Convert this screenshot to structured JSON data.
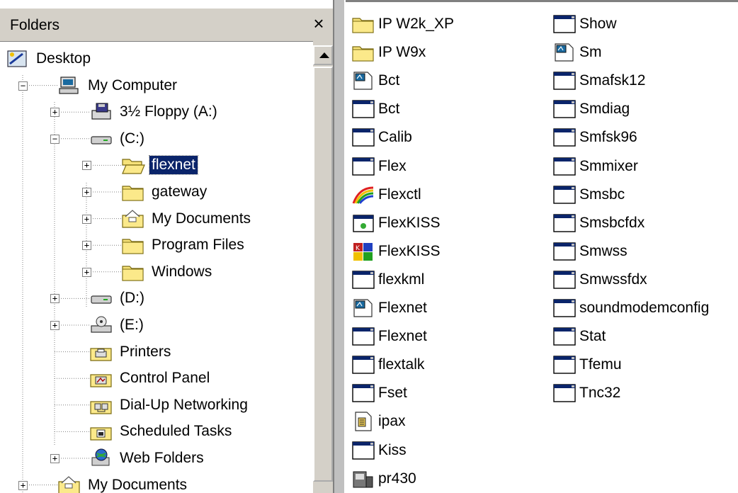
{
  "folders_header": {
    "title": "Folders",
    "close_glyph": "×"
  },
  "tree": [
    {
      "label": "Desktop",
      "icon": "desktop-icon",
      "level": 0,
      "expander": "none"
    },
    {
      "label": "My Computer",
      "icon": "computer-icon",
      "level": 1,
      "expander": "minus"
    },
    {
      "label": "3½ Floppy (A:)",
      "icon": "floppy-drive-icon",
      "level": 2,
      "expander": "plus"
    },
    {
      "label": "(C:)",
      "icon": "hard-drive-icon",
      "level": 2,
      "expander": "minus"
    },
    {
      "label": "flexnet",
      "icon": "open-folder-icon",
      "level": 3,
      "expander": "plus",
      "selected": true
    },
    {
      "label": "gateway",
      "icon": "folder-icon",
      "level": 3,
      "expander": "plus"
    },
    {
      "label": "My Documents",
      "icon": "documents-folder-icon",
      "level": 3,
      "expander": "plus"
    },
    {
      "label": "Program Files",
      "icon": "folder-icon",
      "level": 3,
      "expander": "plus"
    },
    {
      "label": "Windows",
      "icon": "folder-icon",
      "level": 3,
      "expander": "plus"
    },
    {
      "label": "(D:)",
      "icon": "hard-drive-icon",
      "level": 2,
      "expander": "plus"
    },
    {
      "label": "(E:)",
      "icon": "cd-drive-icon",
      "level": 2,
      "expander": "plus"
    },
    {
      "label": "Printers",
      "icon": "printers-folder-icon",
      "level": 2,
      "expander": "none"
    },
    {
      "label": "Control Panel",
      "icon": "control-panel-icon",
      "level": 2,
      "expander": "none"
    },
    {
      "label": "Dial-Up Networking",
      "icon": "dialup-networking-icon",
      "level": 2,
      "expander": "none"
    },
    {
      "label": "Scheduled Tasks",
      "icon": "scheduled-tasks-icon",
      "level": 2,
      "expander": "none"
    },
    {
      "label": "Web Folders",
      "icon": "web-folders-icon",
      "level": 2,
      "expander": "plus"
    },
    {
      "label": "My Documents",
      "icon": "documents-folder-icon",
      "level": 1,
      "expander": "plus"
    }
  ],
  "files_col1": [
    {
      "name": "IP W2k_XP",
      "icon": "folder-icon"
    },
    {
      "name": "IP W9x",
      "icon": "folder-icon"
    },
    {
      "name": "Bct",
      "icon": "pif-icon"
    },
    {
      "name": "Bct",
      "icon": "app-window-icon"
    },
    {
      "name": "Calib",
      "icon": "app-window-icon"
    },
    {
      "name": "Flex",
      "icon": "app-window-icon"
    },
    {
      "name": "Flexctl",
      "icon": "rainbow-app-icon"
    },
    {
      "name": "FlexKISS",
      "icon": "app-small-icon"
    },
    {
      "name": "FlexKISS",
      "icon": "flexkiss-app-icon"
    },
    {
      "name": "flexkml",
      "icon": "app-window-icon"
    },
    {
      "name": "Flexnet",
      "icon": "pif-icon"
    },
    {
      "name": "Flexnet",
      "icon": "app-window-icon"
    },
    {
      "name": "flextalk",
      "icon": "app-window-icon"
    },
    {
      "name": "Fset",
      "icon": "app-window-icon"
    },
    {
      "name": "ipax",
      "icon": "config-file-icon"
    },
    {
      "name": "Kiss",
      "icon": "app-window-icon"
    },
    {
      "name": "pr430",
      "icon": "pr430-app-icon"
    }
  ],
  "files_col2": [
    {
      "name": "Show",
      "icon": "app-window-icon"
    },
    {
      "name": "Sm",
      "icon": "pif-icon"
    },
    {
      "name": "Smafsk12",
      "icon": "app-window-icon"
    },
    {
      "name": "Smdiag",
      "icon": "app-window-icon"
    },
    {
      "name": "Smfsk96",
      "icon": "app-window-icon"
    },
    {
      "name": "Smmixer",
      "icon": "app-window-icon"
    },
    {
      "name": "Smsbc",
      "icon": "app-window-icon"
    },
    {
      "name": "Smsbcfdx",
      "icon": "app-window-icon"
    },
    {
      "name": "Smwss",
      "icon": "app-window-icon"
    },
    {
      "name": "Smwssfdx",
      "icon": "app-window-icon"
    },
    {
      "name": "soundmodemconfig",
      "icon": "app-window-icon"
    },
    {
      "name": "Stat",
      "icon": "app-window-icon"
    },
    {
      "name": "Tfemu",
      "icon": "app-window-icon"
    },
    {
      "name": "Tnc32",
      "icon": "app-window-icon"
    }
  ]
}
